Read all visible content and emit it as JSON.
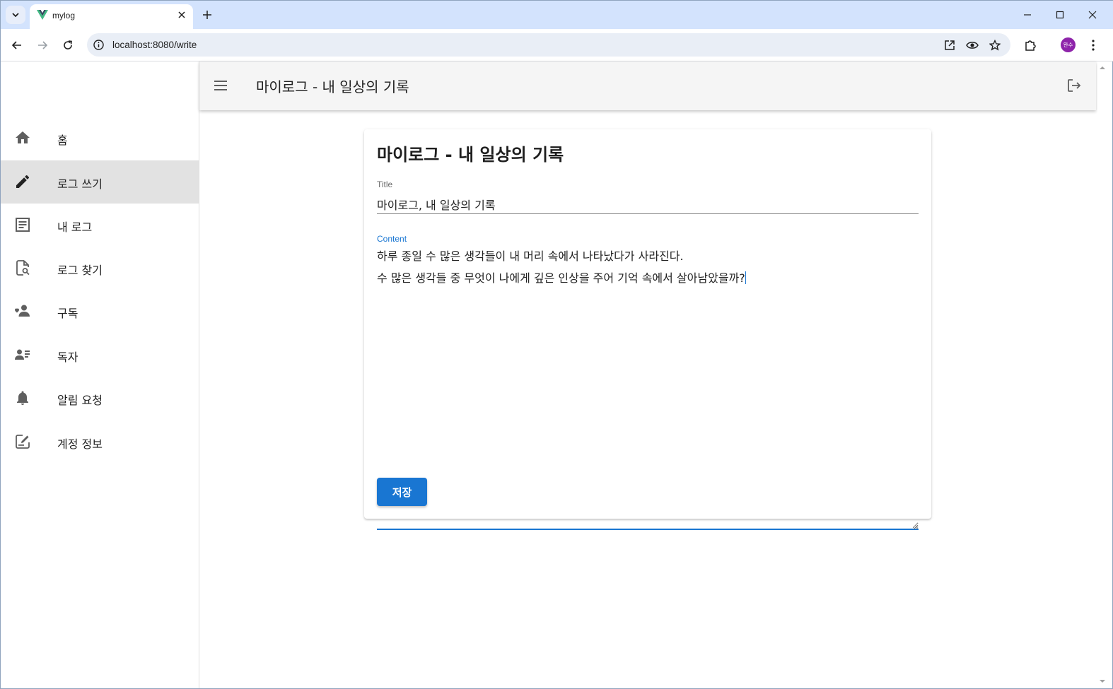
{
  "browser": {
    "tab_title": "mylog",
    "url": "localhost:8080/write",
    "avatar_label": "완수"
  },
  "app_bar": {
    "title": "마이로그 - 내 일상의 기록"
  },
  "drawer": {
    "items": [
      {
        "label": "홈",
        "icon": "home-icon"
      },
      {
        "label": "로그 쓰기",
        "icon": "pencil-icon",
        "active": true
      },
      {
        "label": "내 로그",
        "icon": "article-icon"
      },
      {
        "label": "로그 찾기",
        "icon": "find-document-icon"
      },
      {
        "label": "구독",
        "icon": "person-heart-icon"
      },
      {
        "label": "독자",
        "icon": "person-list-icon"
      },
      {
        "label": "알림 요청",
        "icon": "bell-icon"
      },
      {
        "label": "계정 정보",
        "icon": "edit-note-icon"
      }
    ]
  },
  "editor": {
    "heading": "마이로그 - 내 일상의 기록",
    "title_label": "Title",
    "title_value": "마이로그, 내 일상의 기록",
    "content_label": "Content",
    "content_lines": [
      "하루 종일 수 많은 생각들이 내 머리 속에서 나타났다가 사라진다.",
      "수 많은 생각들 중 무엇이 나에게 깊은 인상을 주어 기억 속에서 살아남았을까?"
    ],
    "save_label": "저장"
  },
  "colors": {
    "primary": "#1976d2",
    "app_bar_bg": "#f5f5f5",
    "active_nav_bg": "#e2e2e2",
    "tab_strip_bg": "#d3e3fd",
    "avatar_bg": "#8e24aa"
  }
}
